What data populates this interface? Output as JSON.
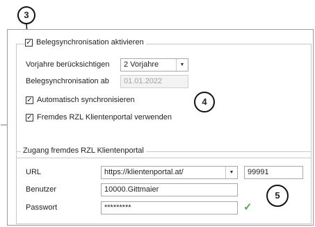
{
  "callouts": {
    "c3": "3",
    "c4": "4",
    "c5": "5"
  },
  "sync": {
    "enable_label": "Belegsynchronisation aktivieren",
    "enable_checked": true,
    "years_label": "Vorjahre berücksichtigen",
    "years_value": "2 Vorjahre",
    "from_label": "Belegsynchronisation ab",
    "from_value": "01.01.2022",
    "auto_label": "Automatisch synchronisieren",
    "auto_checked": true,
    "foreign_label": "Fremdes RZL Klientenportal verwenden",
    "foreign_checked": true
  },
  "access": {
    "title": "Zugang fremdes RZL Klientenportal",
    "url_label": "URL",
    "url_value": "https://klientenportal.at/",
    "port_value": "99991",
    "user_label": "Benutzer",
    "user_value": "10000.Gittmaier",
    "password_label": "Passwort",
    "password_value": "*********",
    "check_mark": "✓",
    "check_color": "#4caf50"
  },
  "glyphs": {
    "checked": "✓",
    "dropdown": "▼"
  }
}
